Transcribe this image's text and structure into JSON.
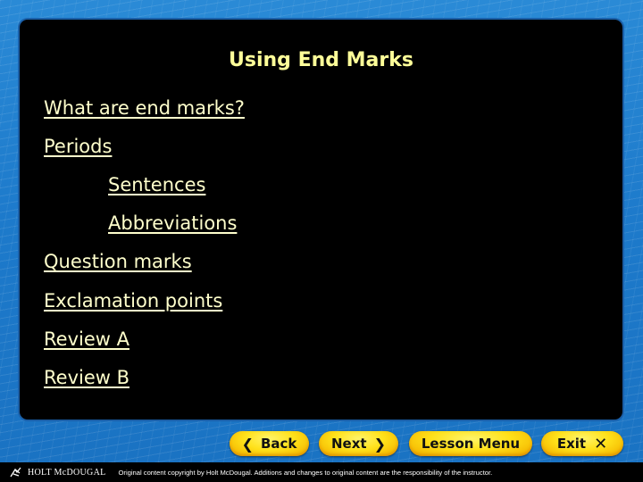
{
  "slide": {
    "title": "Using End Marks",
    "links": [
      {
        "label": "What are end marks?",
        "level": 1
      },
      {
        "label": "Periods",
        "level": 1
      },
      {
        "label": "Sentences",
        "level": 2
      },
      {
        "label": "Abbreviations",
        "level": 2
      },
      {
        "label": "Question marks",
        "level": 1
      },
      {
        "label": "Exclamation points",
        "level": 1
      },
      {
        "label": "Review A",
        "level": 1
      },
      {
        "label": "Review B",
        "level": 1
      }
    ]
  },
  "nav": {
    "back": {
      "label": "Back",
      "icon": "chevron-left-icon",
      "glyph": "❮"
    },
    "next": {
      "label": "Next",
      "icon": "chevron-right-icon",
      "glyph": "❯"
    },
    "lesson_menu": {
      "label": "Lesson Menu"
    },
    "exit": {
      "label": "Exit",
      "icon": "close-icon",
      "glyph": "✕"
    }
  },
  "footer": {
    "brand": "HOLT McDOUGAL",
    "copyright": "Original content copyright by Holt McDougal. Additions and changes to original content are the responsibility of the instructor."
  },
  "colors": {
    "background": "#1f7fcc",
    "panel": "#000000",
    "title": "#ffff99",
    "link": "#ffffcc",
    "button": "#ffe11a"
  }
}
